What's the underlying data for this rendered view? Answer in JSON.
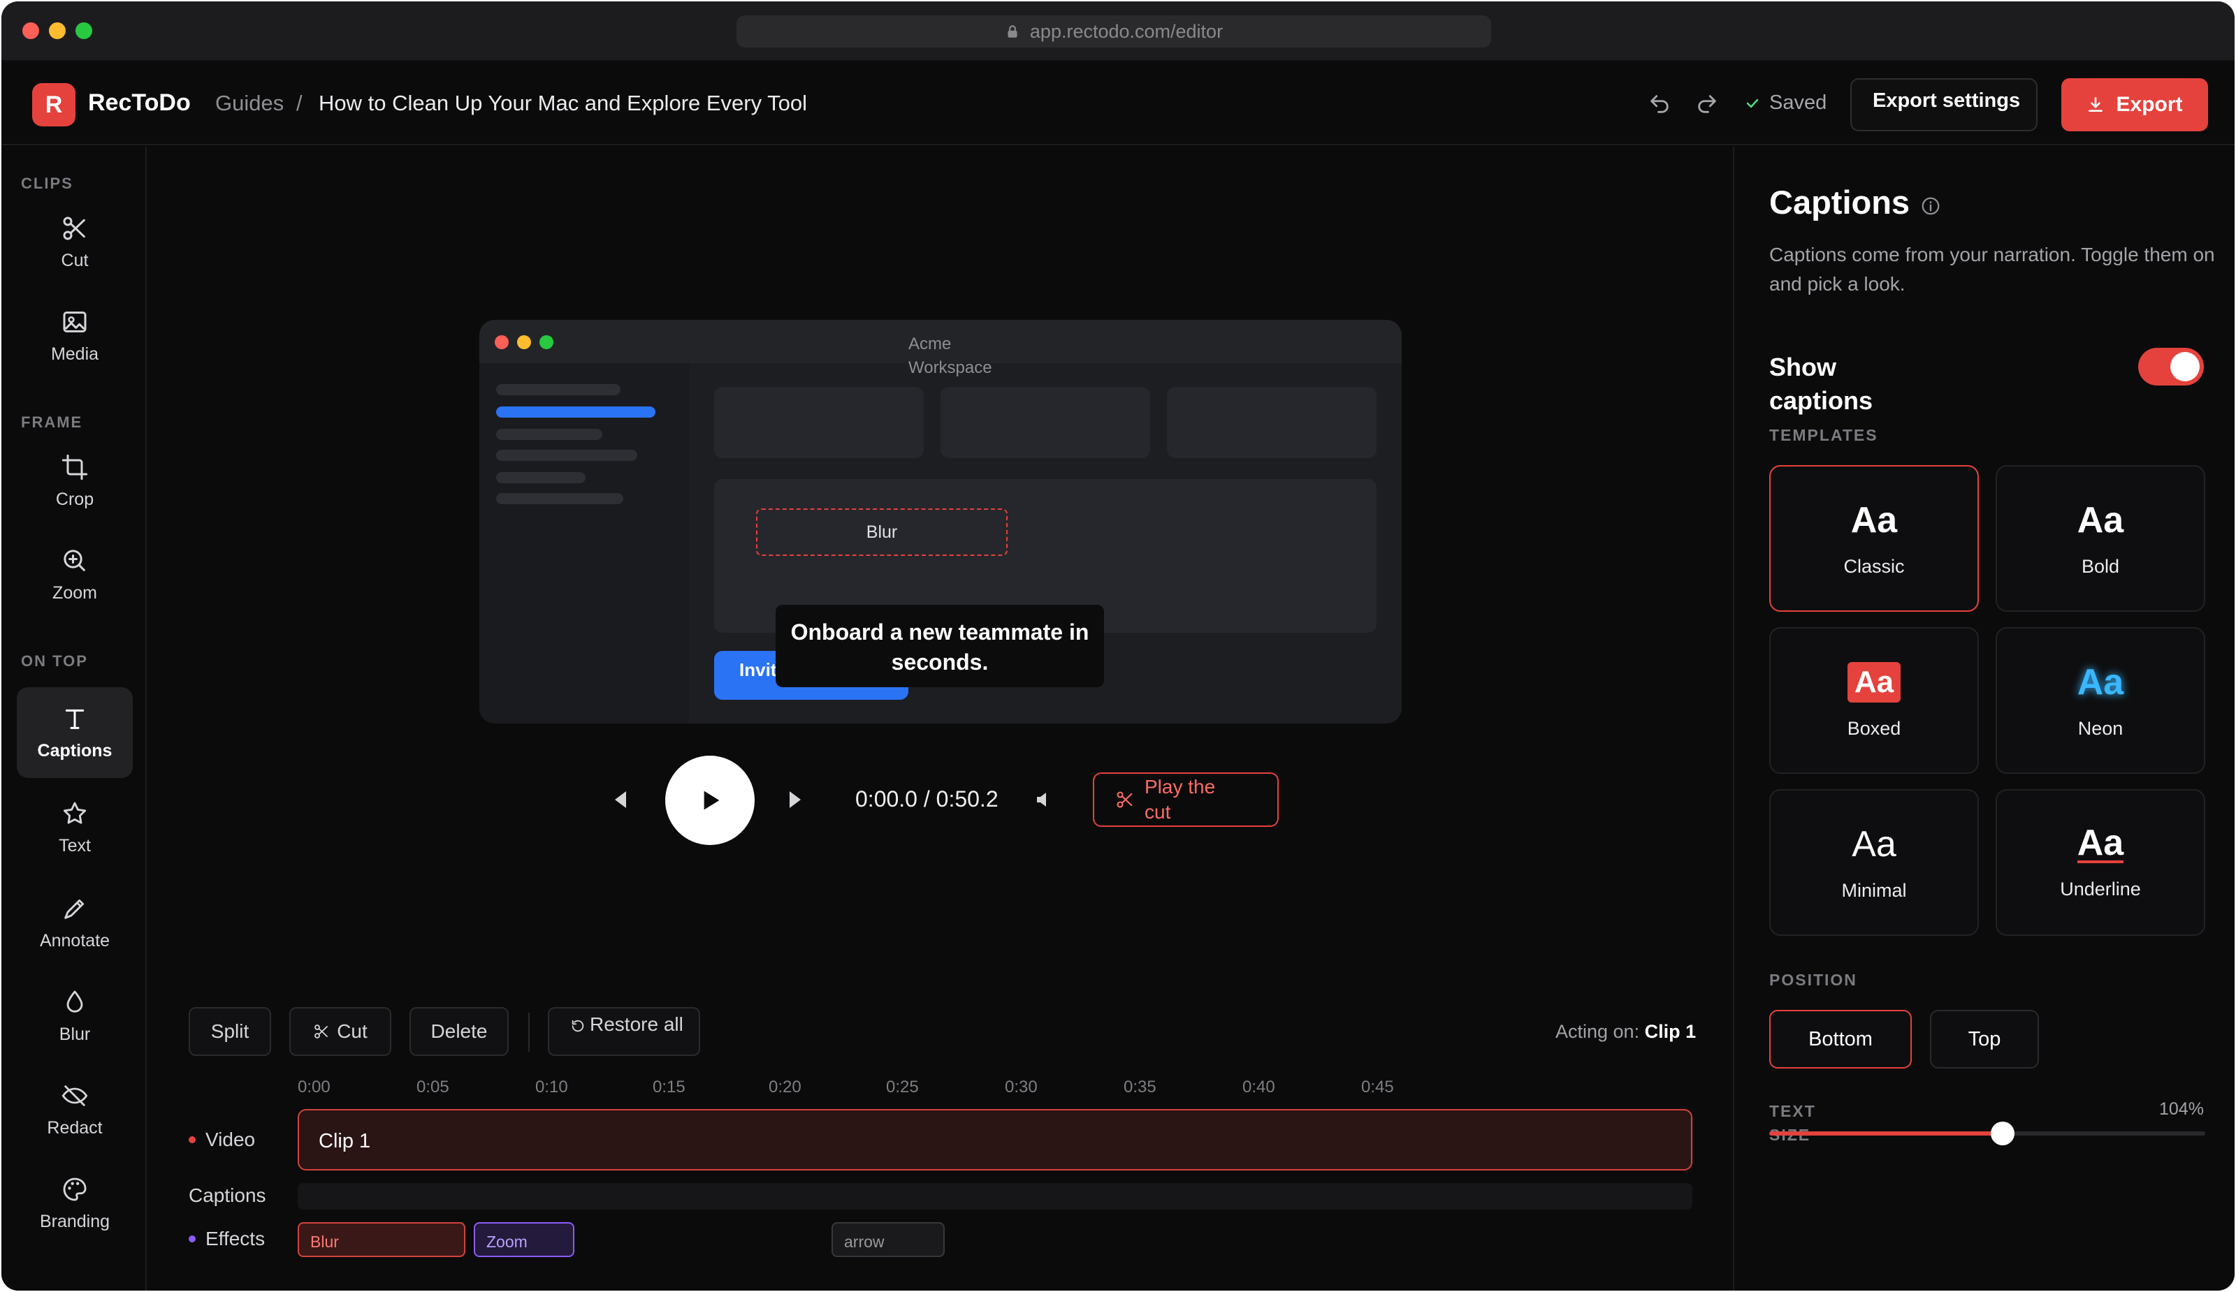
{
  "browser": {
    "url": "app.rectodo.com/editor"
  },
  "header": {
    "logo_letter": "R",
    "brand": "RecToDo",
    "breadcrumb_parent": "Guides",
    "breadcrumb_sep": "/",
    "title": "How to Clean Up Your Mac and Explore Every Tool",
    "saved_label": "Saved",
    "export_settings_label": "Export settings",
    "export_label": "Export"
  },
  "sidebar": {
    "sections": {
      "clips": "CLIPS",
      "frame": "FRAME",
      "on_top": "ON TOP"
    },
    "tools": {
      "cut": "Cut",
      "media": "Media",
      "crop": "Crop",
      "zoom": "Zoom",
      "captions": "Captions",
      "text": "Text",
      "annotate": "Annotate",
      "blur": "Blur",
      "redact": "Redact",
      "branding": "Branding"
    },
    "active_tool": "Captions"
  },
  "preview": {
    "window_title": "Acme Workspace",
    "blur_label": "Blur",
    "button_label": "Invite teammate",
    "caption_text": "Onboard a new teammate in seconds."
  },
  "player": {
    "time": "0:00.0 / 0:50.2",
    "play_cut_label": "Play the cut"
  },
  "timeline": {
    "actions": {
      "split": "Split",
      "cut": "Cut",
      "delete": "Delete",
      "restore": "Restore all"
    },
    "acting_prefix": "Acting on:",
    "acting_clip": "Clip 1",
    "ticks": [
      "0:00",
      "0:05",
      "0:10",
      "0:15",
      "0:20",
      "0:25",
      "0:30",
      "0:35",
      "0:40",
      "0:45"
    ],
    "tracks": {
      "video": {
        "name": "Video",
        "clip": "Clip 1"
      },
      "captions": {
        "name": "Captions"
      },
      "effects": {
        "name": "Effects",
        "items": [
          "Blur",
          "Zoom",
          "arrow"
        ]
      }
    }
  },
  "captions_panel": {
    "title": "Captions",
    "description": "Captions come from your narration. Toggle them on and pick a look.",
    "show_label": "Show captions",
    "show_enabled": true,
    "templates_heading": "TEMPLATES",
    "sample": "Aa",
    "templates": [
      "Classic",
      "Bold",
      "Boxed",
      "Neon",
      "Minimal",
      "Underline"
    ],
    "selected_template": "Classic",
    "position_heading": "POSITION",
    "positions": [
      "Bottom",
      "Top"
    ],
    "selected_position": "Bottom",
    "text_size_label": "TEXT SIZE",
    "text_size_value": "104%",
    "text_size_fraction": 0.535
  },
  "colors": {
    "accent": "#e5423d",
    "background": "#0b0b0c",
    "preview_button": "#2b73f5",
    "neon": "#3ab7ff",
    "zoom_effect": "#8b5cf6"
  }
}
